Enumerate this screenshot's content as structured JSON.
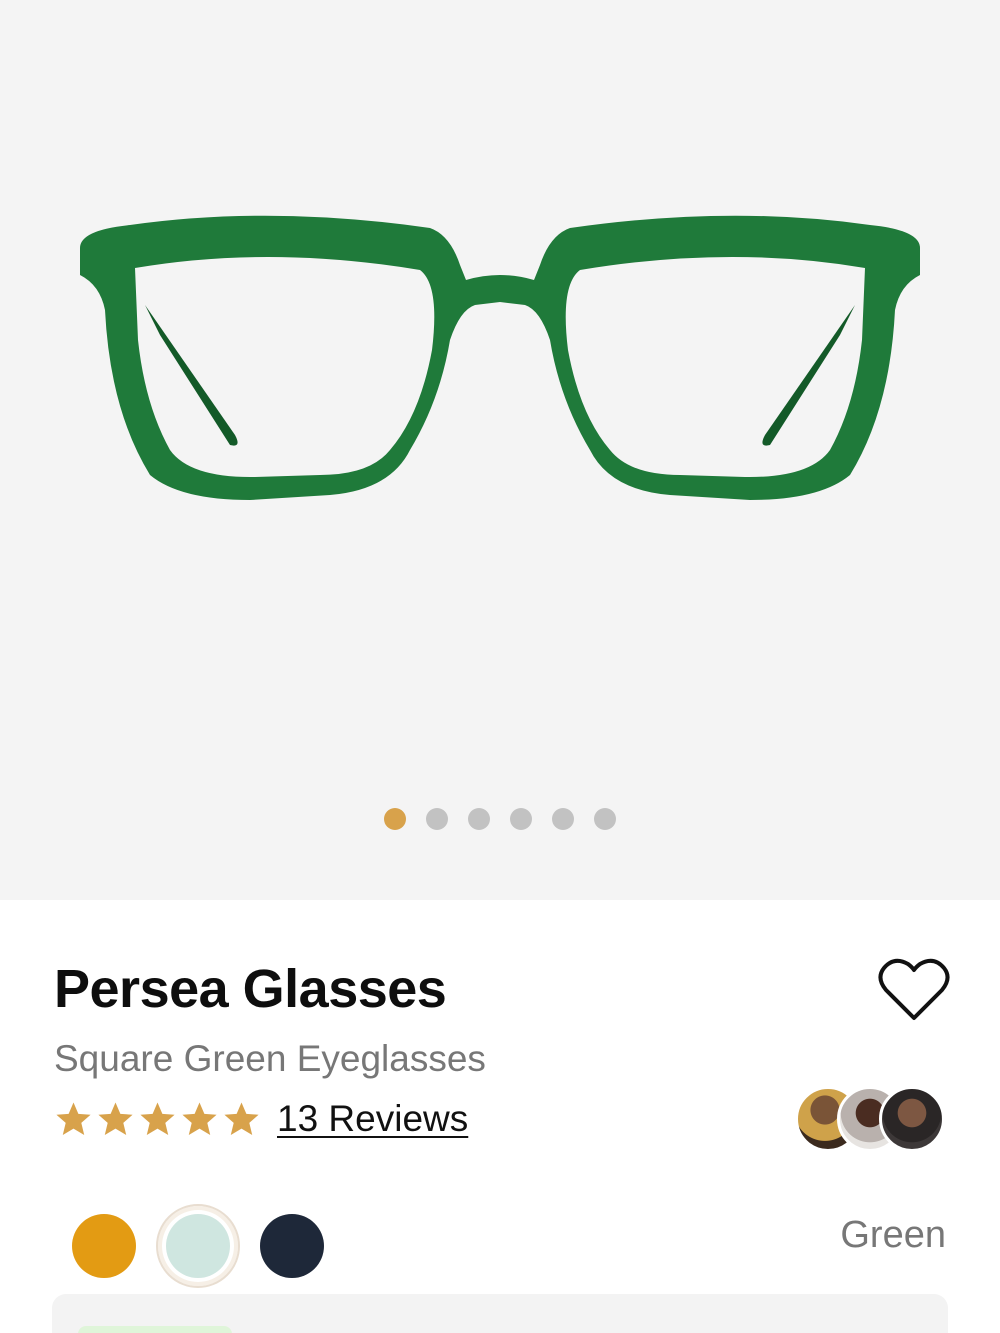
{
  "gallery": {
    "image_alt": "green square eyeglasses",
    "dots": [
      true,
      false,
      false,
      false,
      false,
      false
    ],
    "colors": {
      "frame": "#1f7a3a",
      "frame_dark": "#135a28",
      "active_dot": "#d8a24b",
      "dot": "#c2c2c2"
    }
  },
  "product": {
    "title": "Persea Glasses",
    "subtitle": "Square Green Eyeglasses",
    "rating": 5,
    "reviews_label": "13 Reviews",
    "favorite_icon": "heart-icon",
    "star_color": "#d8a24b",
    "avatars": [
      "customer-1",
      "customer-2",
      "customer-3"
    ],
    "selected_color_name": "Green",
    "swatches": [
      {
        "name": "yellow",
        "color": "#e39b13",
        "selected": false
      },
      {
        "name": "mint",
        "color": "#cfe6e0",
        "selected": true
      },
      {
        "name": "navy",
        "color": "#1e2839",
        "selected": false
      }
    ]
  }
}
